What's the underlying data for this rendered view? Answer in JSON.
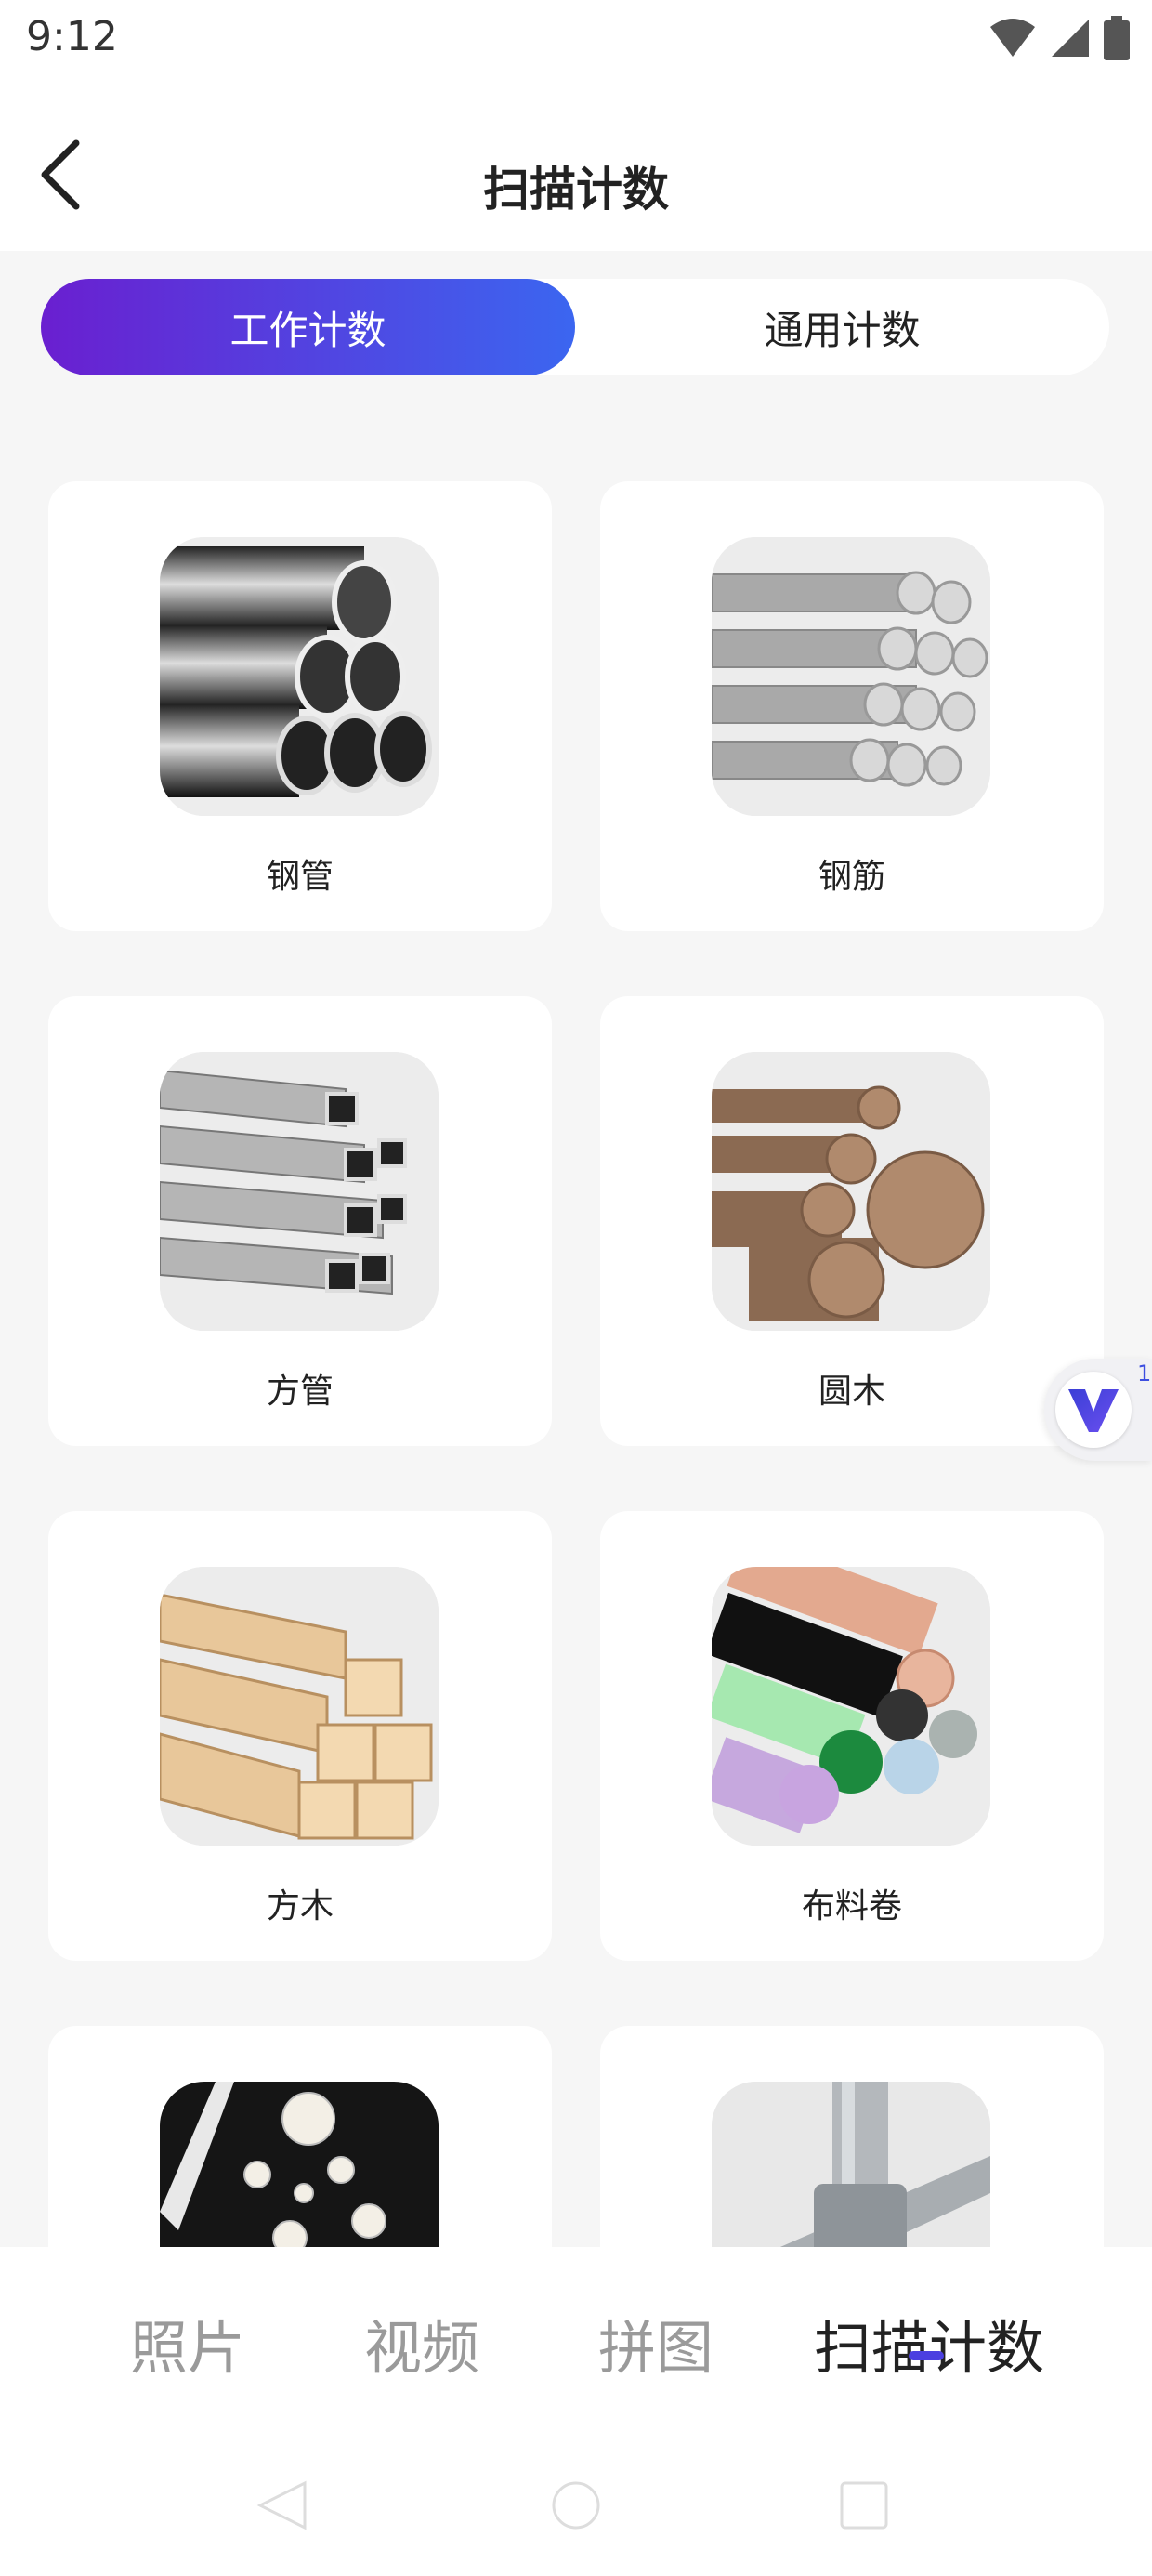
{
  "status_bar": {
    "time": "9:12"
  },
  "header": {
    "title": "扫描计数"
  },
  "segmented": [
    {
      "label": "工作计数",
      "active": true
    },
    {
      "label": "通用计数",
      "active": false
    }
  ],
  "cards": [
    {
      "label": "钢管",
      "icon": "steel-pipe-image"
    },
    {
      "label": "钢筋",
      "icon": "rebar-image"
    },
    {
      "label": "方管",
      "icon": "square-tube-image"
    },
    {
      "label": "圆木",
      "icon": "round-log-image"
    },
    {
      "label": "方木",
      "icon": "square-timber-image"
    },
    {
      "label": "布料卷",
      "icon": "fabric-roll-image"
    },
    {
      "label": "",
      "icon": "pearl-image"
    },
    {
      "label": "",
      "icon": "scaffold-pipe-image"
    }
  ],
  "floating": {
    "count": "1",
    "icon": "v-logo-icon"
  },
  "bottom_nav": [
    {
      "label": "照片",
      "active": false
    },
    {
      "label": "视频",
      "active": false
    },
    {
      "label": "拼图",
      "active": false
    },
    {
      "label": "扫描计数",
      "active": true
    }
  ],
  "colors": {
    "accent_start": "#6a1fd0",
    "accent_end": "#3b66f0",
    "indicator": "#4b3fe0"
  }
}
